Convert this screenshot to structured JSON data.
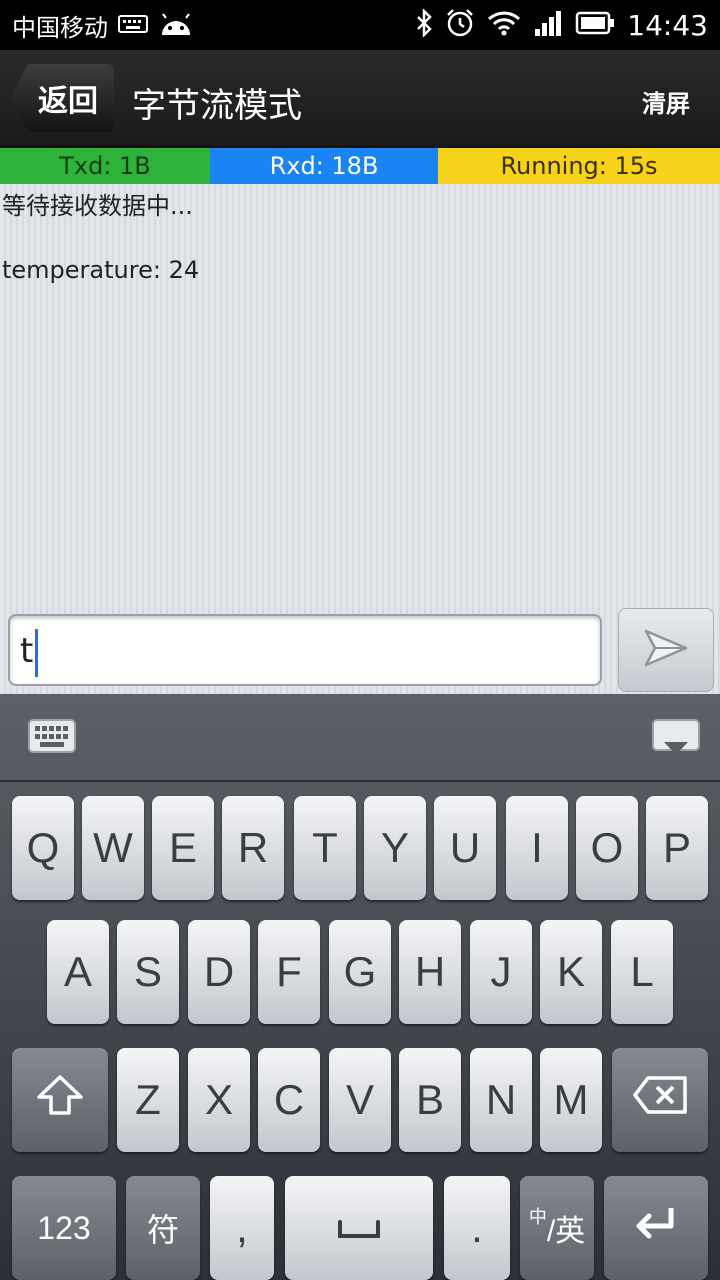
{
  "status_bar": {
    "carrier": "中国移动",
    "time": "14:43"
  },
  "action_bar": {
    "back_label": "返回",
    "title": "字节流模式",
    "clear_label": "清屏"
  },
  "stats": {
    "txd": "Txd: 1B",
    "rxd": "Rxd: 18B",
    "running": "Running: 15s"
  },
  "messages": [
    "等待接收数据中...",
    "temperature: 24"
  ],
  "input": {
    "value": "t"
  },
  "keyboard": {
    "row1": [
      "Q",
      "W",
      "E",
      "R",
      "T",
      "Y",
      "U",
      "I",
      "O",
      "P"
    ],
    "row2": [
      "A",
      "S",
      "D",
      "F",
      "G",
      "H",
      "J",
      "K",
      "L"
    ],
    "row3": [
      "Z",
      "X",
      "C",
      "V",
      "B",
      "N",
      "M"
    ],
    "num_label": "123",
    "symbol_label": "符",
    "comma_label": ",",
    "period_label": ".",
    "lang_label_top": "中",
    "lang_label": "/英"
  },
  "colors": {
    "txd": "#2eb33a",
    "rxd": "#1a84f4",
    "running": "#f7d21a"
  },
  "icons": [
    "keyboard-icon",
    "android-icon",
    "bluetooth-icon",
    "alarm-icon",
    "wifi-icon",
    "signal-icon",
    "battery-icon",
    "send-icon",
    "hide-keyboard-icon",
    "shift-icon",
    "backspace-icon",
    "space-icon",
    "enter-icon"
  ]
}
